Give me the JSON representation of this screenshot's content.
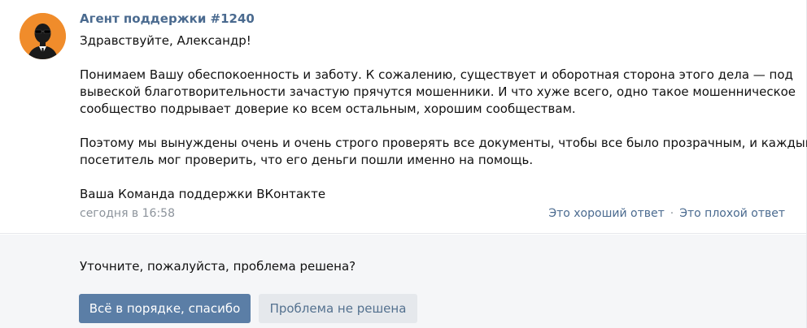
{
  "message": {
    "author": "Агент поддержки #1240",
    "greeting": "Здравствуйте, Александр!",
    "paragraph1_lines": [
      "Понимаем Вашу обеспокоенность и заботу. К сожалению, существует и оборотная сторона этого дела — под",
      "вывеской благотворительности зачастую прячутся мошенники. И что хуже всего, одно такое мошенническое",
      "сообщество подрывает доверие ко всем остальным, хорошим сообществам."
    ],
    "paragraph2_lines": [
      "Поэтому мы вынуждены очень и очень строго проверять все документы, чтобы все было прозрачным, и каждый",
      "посетитель мог проверить, что его деньги пошли именно на помощь."
    ],
    "signature": "Ваша Команда поддержки ВКонтакте",
    "timestamp": "сегодня в 16:58",
    "rate_good": "Это хороший ответ",
    "rate_separator": "·",
    "rate_bad": "Это плохой ответ",
    "avatar_icon": "agent-in-sunglasses-icon"
  },
  "feedback": {
    "question": "Уточните, пожалуйста, проблема решена?",
    "resolved_label": "Всё в порядке, спасибо",
    "unresolved_label": "Проблема не решена"
  },
  "colors": {
    "author_link": "#4a6a8f",
    "avatar_bg": "#f08c2b",
    "primary_button": "#5b7ea6",
    "secondary_button": "#e5e8ec",
    "feedback_bg": "#f5f6f8"
  }
}
